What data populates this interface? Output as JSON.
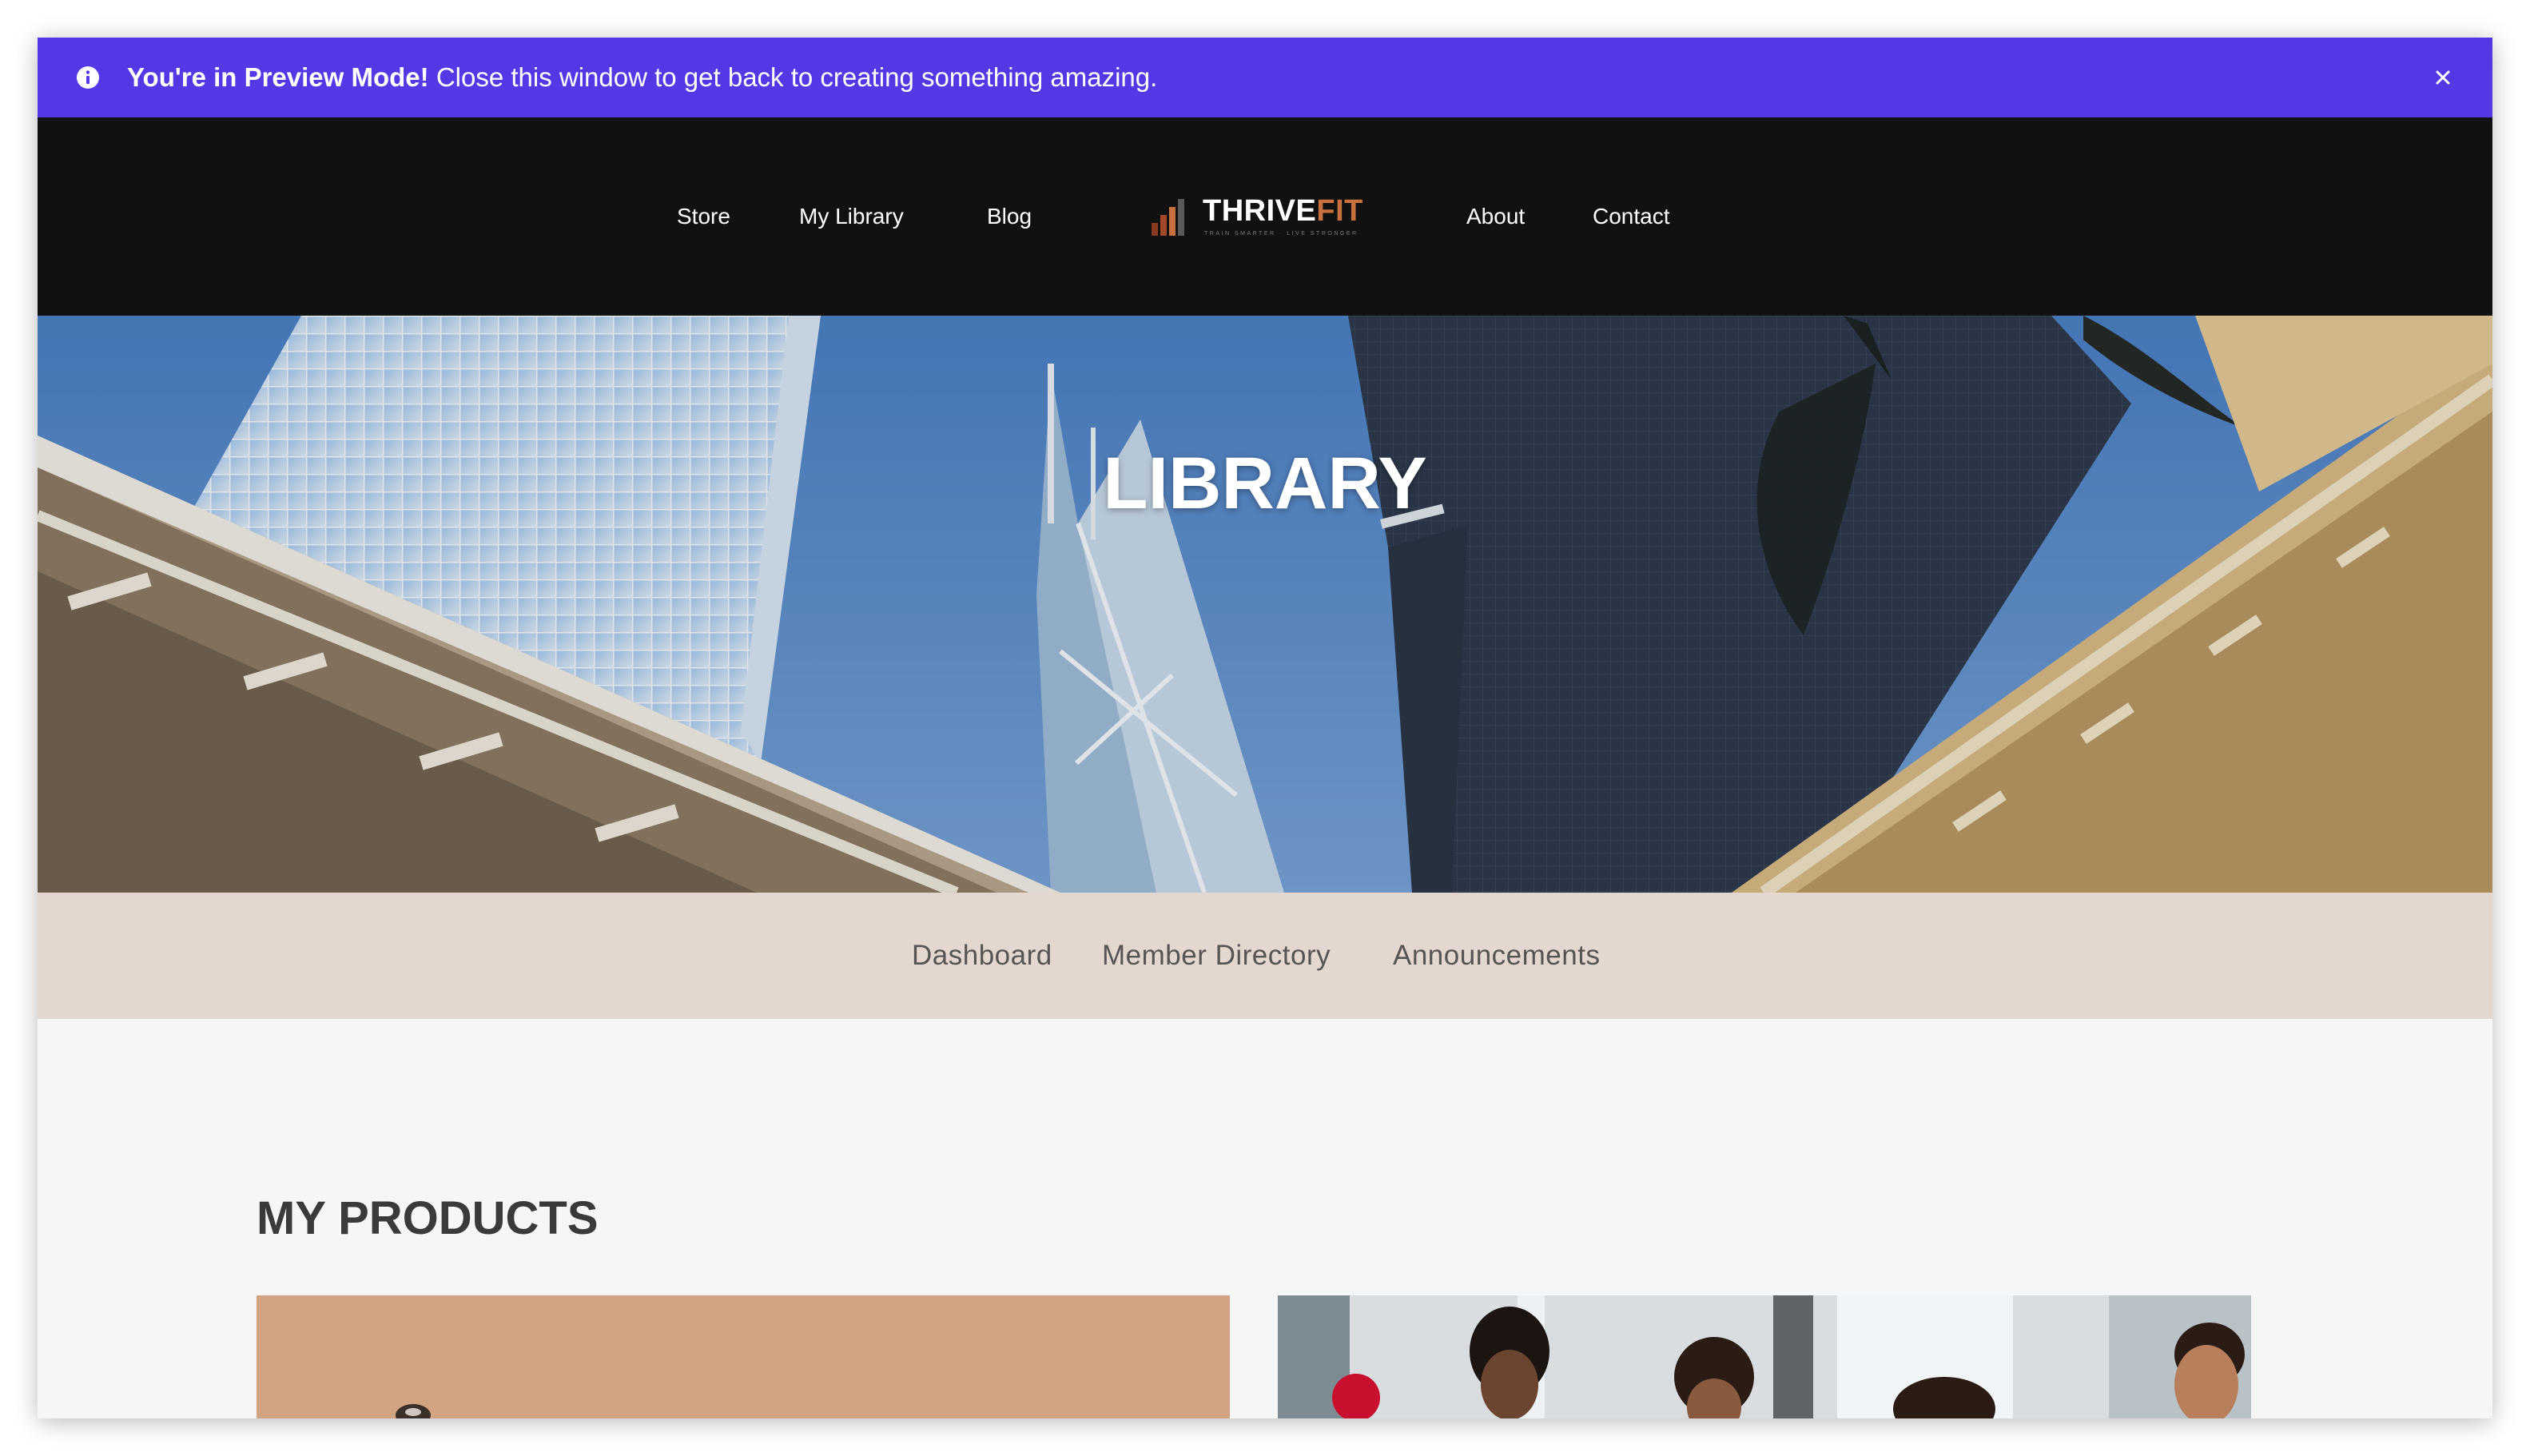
{
  "banner": {
    "bold_text": "You're in Preview Mode!",
    "text": " Close this window to get back to creating something amazing.",
    "icon": "info-icon",
    "close_icon": "close-icon"
  },
  "nav": {
    "left": [
      "Store",
      "My Library",
      "Blog"
    ],
    "right": [
      "About",
      "Contact"
    ]
  },
  "logo": {
    "brand_main": "THRIVE",
    "brand_accent": "FIT",
    "tagline": "TRAIN SMARTER · LIVE STRONGER"
  },
  "hero": {
    "title": "LIBRARY"
  },
  "subnav": [
    "Dashboard",
    "Member Directory",
    "Announcements"
  ],
  "products": {
    "title": "MY PRODUCTS"
  },
  "colors": {
    "banner": "#5338e6",
    "header": "#111111",
    "accent": "#c8703e",
    "subnav": "#e4d7cf",
    "content_bg": "#f6f6f6"
  }
}
